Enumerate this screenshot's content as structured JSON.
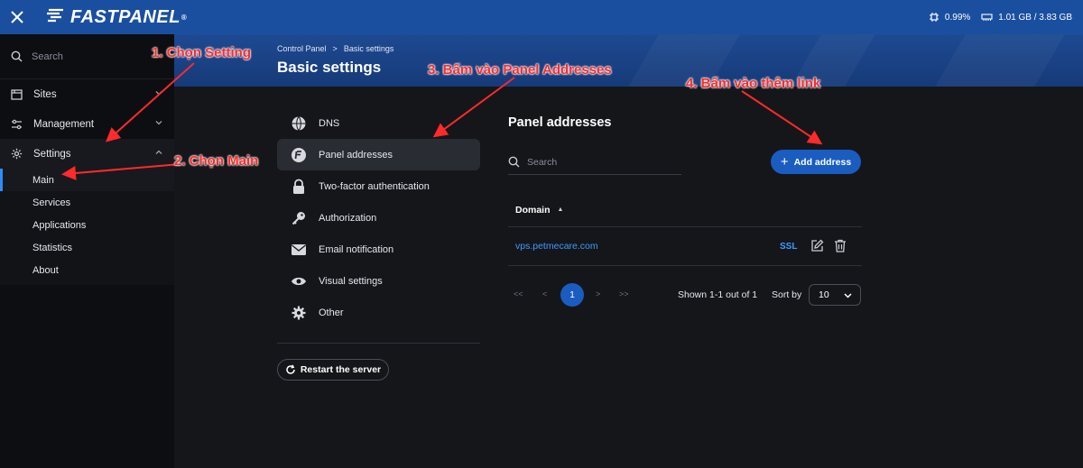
{
  "topbar": {
    "logo_text": "FASTPANEL",
    "logo_mark": "®",
    "cpu": "0.99%",
    "memory": "1.01 GB / 3.83 GB"
  },
  "sidebar": {
    "search_placeholder": "Search",
    "items": [
      {
        "label": "Sites",
        "icon": "sites-icon"
      },
      {
        "label": "Management",
        "icon": "sliders-icon"
      },
      {
        "label": "Settings",
        "icon": "gear-icon"
      }
    ],
    "settings_sub": [
      "Main",
      "Services",
      "Applications",
      "Statistics",
      "About"
    ]
  },
  "header": {
    "breadcrumb": [
      "Control Panel",
      "Basic settings"
    ],
    "breadcrumb_sep": ">",
    "title": "Basic settings"
  },
  "menu": {
    "items": [
      {
        "label": "DNS",
        "icon": "globe-icon"
      },
      {
        "label": "Panel addresses",
        "icon": "fastpanel-f-icon"
      },
      {
        "label": "Two-factor authentication",
        "icon": "lock-icon"
      },
      {
        "label": "Authorization",
        "icon": "key-icon"
      },
      {
        "label": "Email notification",
        "icon": "envelope-icon"
      },
      {
        "label": "Visual settings",
        "icon": "eye-icon"
      },
      {
        "label": "Other",
        "icon": "gear-icon"
      }
    ],
    "restart_label": "Restart the server"
  },
  "panel": {
    "title": "Panel addresses",
    "search_placeholder": "Search",
    "add_label": "Add address",
    "column_domain": "Domain",
    "rows": [
      {
        "domain": "vps.petmecare.com",
        "ssl": "SSL"
      }
    ],
    "pager": {
      "first": "<<",
      "prev": "<",
      "current": "1",
      "next": ">",
      "last": ">>",
      "shown": "Shown 1-1 out of 1",
      "sort_by": "Sort by",
      "per_page": "10"
    }
  },
  "annotations": {
    "step1": "1. Chọn Setting",
    "step2": "2. Chọn Main",
    "step3": "3. Bấm vào Panel Addresses",
    "step4": "4. Bấm vào thêm  link"
  },
  "colors": {
    "topbar": "#1a4fa0",
    "accent": "#1b5cc0",
    "link": "#3d9bff",
    "annotation": "#ff2a2a"
  }
}
